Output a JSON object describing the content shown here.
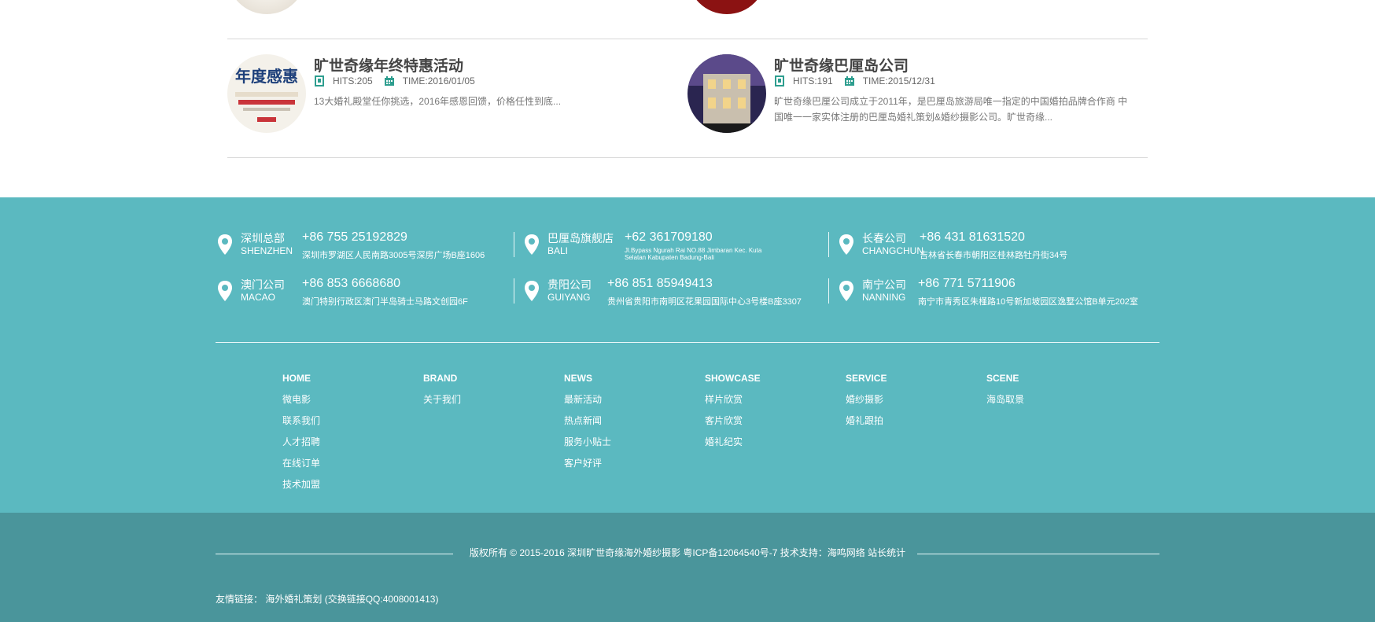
{
  "news": {
    "items": [
      {
        "title": "旷世奇缘年终特惠活动",
        "hits_label": "HITS:205",
        "time_label": "TIME:2016/01/05",
        "desc": "13大婚礼殿堂任你挑选，2016年感恩回馈，价格任性到底..."
      },
      {
        "title": "旷世奇缘巴厘岛公司",
        "hits_label": "HITS:191",
        "time_label": "TIME:2015/12/31",
        "desc": "旷世奇缘巴厘公司成立于2011年，是巴厘岛旅游局唯一指定的中国婚拍品牌合作商 中国唯一一家实体注册的巴厘岛婚礼策划&婚纱摄影公司。旷世奇缘..."
      }
    ]
  },
  "offices": [
    {
      "cn": "深圳总部",
      "en": "SHENZHEN",
      "phone": "+86 755 25192829",
      "addr": "深圳市罗湖区人民南路3005号深房广场B座1606"
    },
    {
      "cn": "巴厘岛旗舰店",
      "en": "BALI",
      "phone": "+62 361709180",
      "addr": "Jl.Bypass Ngurah Rai NO.88 Jimbaran Kec. Kuta Selatan Kabupaten Badung-Bali"
    },
    {
      "cn": "长春公司",
      "en": "CHANGCHUN",
      "phone": "+86 431 81631520",
      "addr": "吉林省长春市朝阳区桂林路牡丹街34号"
    },
    {
      "cn": "澳门公司",
      "en": "MACAO",
      "phone": "+86 853 6668680",
      "addr": "澳门特别行政区澳门半岛骑士马路文创园6F"
    },
    {
      "cn": "贵阳公司",
      "en": "GUIYANG",
      "phone": "+86 851 85949413",
      "addr": "贵州省贵阳市南明区花果园国际中心3号楼B座3307"
    },
    {
      "cn": "南宁公司",
      "en": "NANNING",
      "phone": "+86 771 5711906",
      "addr": "南宁市青秀区朱槿路10号新加坡园区逸墅公馆B单元202室"
    }
  ],
  "nav": [
    {
      "head": "HOME",
      "links": [
        "微电影",
        "联系我们",
        "人才招聘",
        "在线订单",
        "技术加盟"
      ]
    },
    {
      "head": "BRAND",
      "links": [
        "关于我们"
      ]
    },
    {
      "head": "NEWS",
      "links": [
        "最新活动",
        "热点新闻",
        "服务小贴士",
        "客户好评"
      ]
    },
    {
      "head": "SHOWCASE",
      "links": [
        "样片欣赏",
        "客片欣赏",
        "婚礼纪实"
      ]
    },
    {
      "head": "SERVICE",
      "links": [
        "婚纱摄影",
        "婚礼跟拍"
      ]
    },
    {
      "head": "SCENE",
      "links": [
        "海岛取景"
      ]
    }
  ],
  "footer": {
    "copyright": "版权所有 © 2015-2016 深圳旷世奇缘海外婚纱摄影 粤ICP备12064540号-7 技术支持：海鸣网络 站长统计",
    "links_label": "友情链接：",
    "link_1": "海外婚礼策划",
    "link_2": "(交换链接QQ:4008001413)"
  },
  "colors": {
    "teal": "#5bb9c0",
    "teal_dark": "#4a959b",
    "icon_green": "#2e9e8f"
  }
}
